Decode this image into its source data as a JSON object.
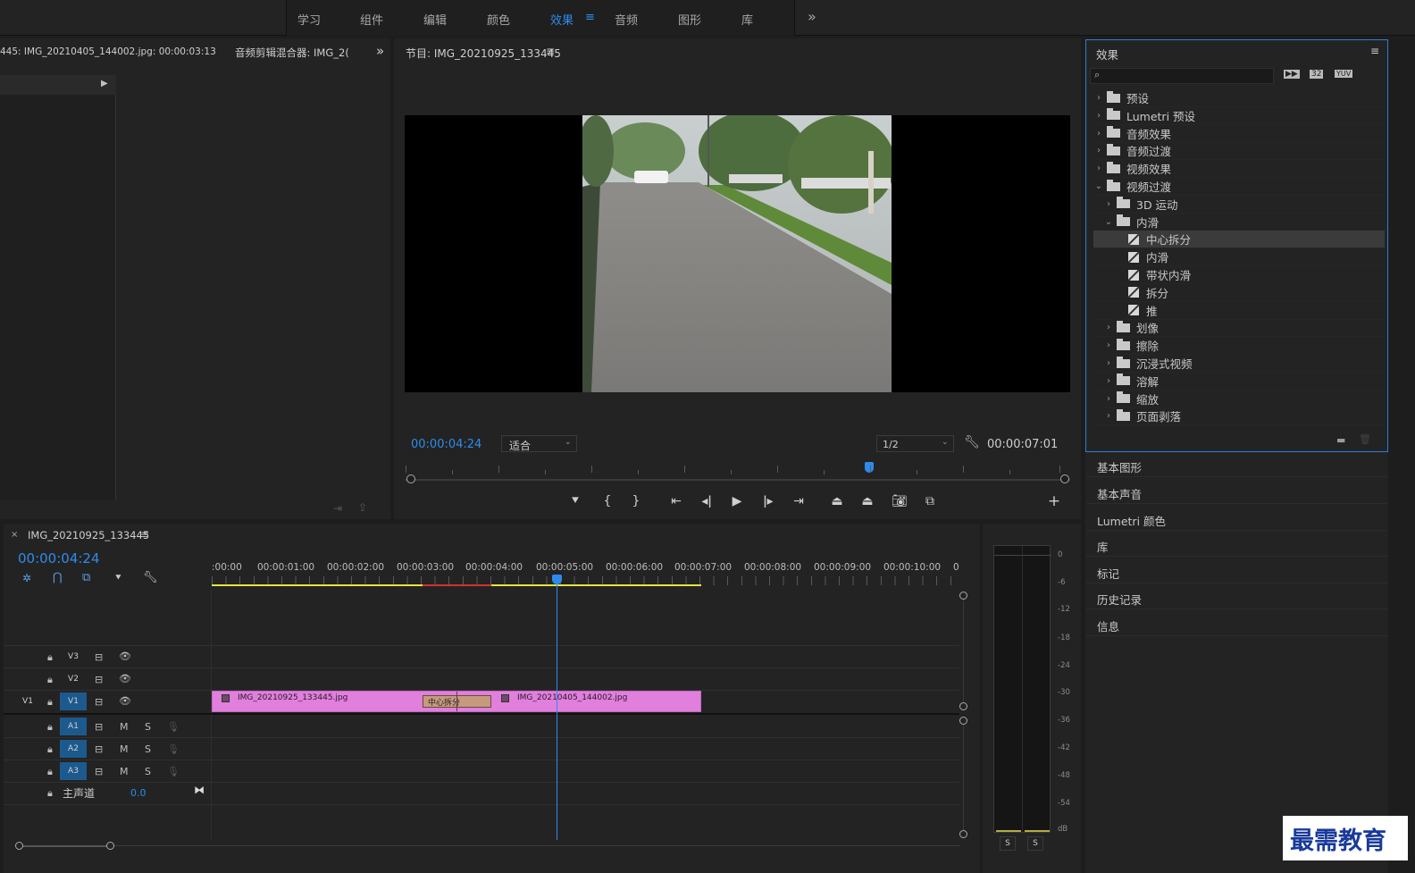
{
  "workspaces": [
    "学习",
    "组件",
    "编辑",
    "颜色",
    "效果",
    "音频",
    "图形",
    "库"
  ],
  "active_workspace": "效果",
  "menu_icon": "≡",
  "overflow_icon": "»",
  "source_panel": {
    "tab1": "445: IMG_20210405_144002.jpg: 00:00:03:13",
    "tab2": "音频剪辑混合器: IMG_2("
  },
  "program_monitor": {
    "title": "节目: IMG_20210925_133445",
    "current_time": "00:00:04:24",
    "fit_label": "适合",
    "resolution": "1/2",
    "duration": "00:00:07:01"
  },
  "effects_panel": {
    "title": "效果",
    "search_placeholder": "",
    "filter_icons": [
      "加速",
      "32",
      "YUV"
    ],
    "tree": [
      {
        "label": "预设",
        "level": 0,
        "type": "folder-preset",
        "expanded": false
      },
      {
        "label": "Lumetri 预设",
        "level": 0,
        "type": "folder-preset",
        "expanded": false
      },
      {
        "label": "音频效果",
        "level": 0,
        "type": "folder",
        "expanded": false
      },
      {
        "label": "音频过渡",
        "level": 0,
        "type": "folder",
        "expanded": false
      },
      {
        "label": "视频效果",
        "level": 0,
        "type": "folder",
        "expanded": false
      },
      {
        "label": "视频过渡",
        "level": 0,
        "type": "folder",
        "expanded": true
      },
      {
        "label": "3D 运动",
        "level": 1,
        "type": "folder",
        "expanded": false
      },
      {
        "label": "内滑",
        "level": 1,
        "type": "folder",
        "expanded": true
      },
      {
        "label": "中心拆分",
        "level": 2,
        "type": "effect",
        "selected": true
      },
      {
        "label": "内滑",
        "level": 2,
        "type": "effect"
      },
      {
        "label": "带状内滑",
        "level": 2,
        "type": "effect"
      },
      {
        "label": "拆分",
        "level": 2,
        "type": "effect"
      },
      {
        "label": "推",
        "level": 2,
        "type": "effect"
      },
      {
        "label": "划像",
        "level": 1,
        "type": "folder",
        "expanded": false
      },
      {
        "label": "擦除",
        "level": 1,
        "type": "folder",
        "expanded": false
      },
      {
        "label": "沉浸式视频",
        "level": 1,
        "type": "folder",
        "expanded": false
      },
      {
        "label": "溶解",
        "level": 1,
        "type": "folder",
        "expanded": false
      },
      {
        "label": "缩放",
        "level": 1,
        "type": "folder",
        "expanded": false
      },
      {
        "label": "页面剥落",
        "level": 1,
        "type": "folder",
        "expanded": false
      }
    ]
  },
  "side_panels": [
    "基本图形",
    "基本声音",
    "Lumetri 颜色",
    "库",
    "标记",
    "历史记录",
    "信息"
  ],
  "timeline": {
    "sequence_name": "IMG_20210925_133445",
    "current_time": "00:00:04:24",
    "ruler": [
      ":00:00",
      "00:00:01:00",
      "00:00:02:00",
      "00:00:03:00",
      "00:00:04:00",
      "00:00:05:00",
      "00:00:06:00",
      "00:00:07:00",
      "00:00:08:00",
      "00:00:09:00",
      "00:00:10:00",
      "0"
    ],
    "tracks_video": [
      "V3",
      "V2",
      "V1"
    ],
    "tracks_audio": [
      "A1",
      "A2",
      "A3"
    ],
    "source_patch": "V1",
    "mute_label": "M",
    "solo_label": "S",
    "master_label": "主声道",
    "master_value": "0.0",
    "clips": [
      {
        "name": "IMG_20210925_133445.jpg",
        "color": "#e07fdc"
      },
      {
        "name": "IMG_20210405_144002.jpg",
        "color": "#e07fdc"
      }
    ],
    "transition": "中心拆分"
  },
  "meter": {
    "scale": [
      "0",
      "-6",
      "-12",
      "-18",
      "-24",
      "-30",
      "-36",
      "-42",
      "-48",
      "-54",
      "dB"
    ],
    "solo_buttons": [
      "S",
      "S"
    ]
  },
  "watermark": "最需教育"
}
